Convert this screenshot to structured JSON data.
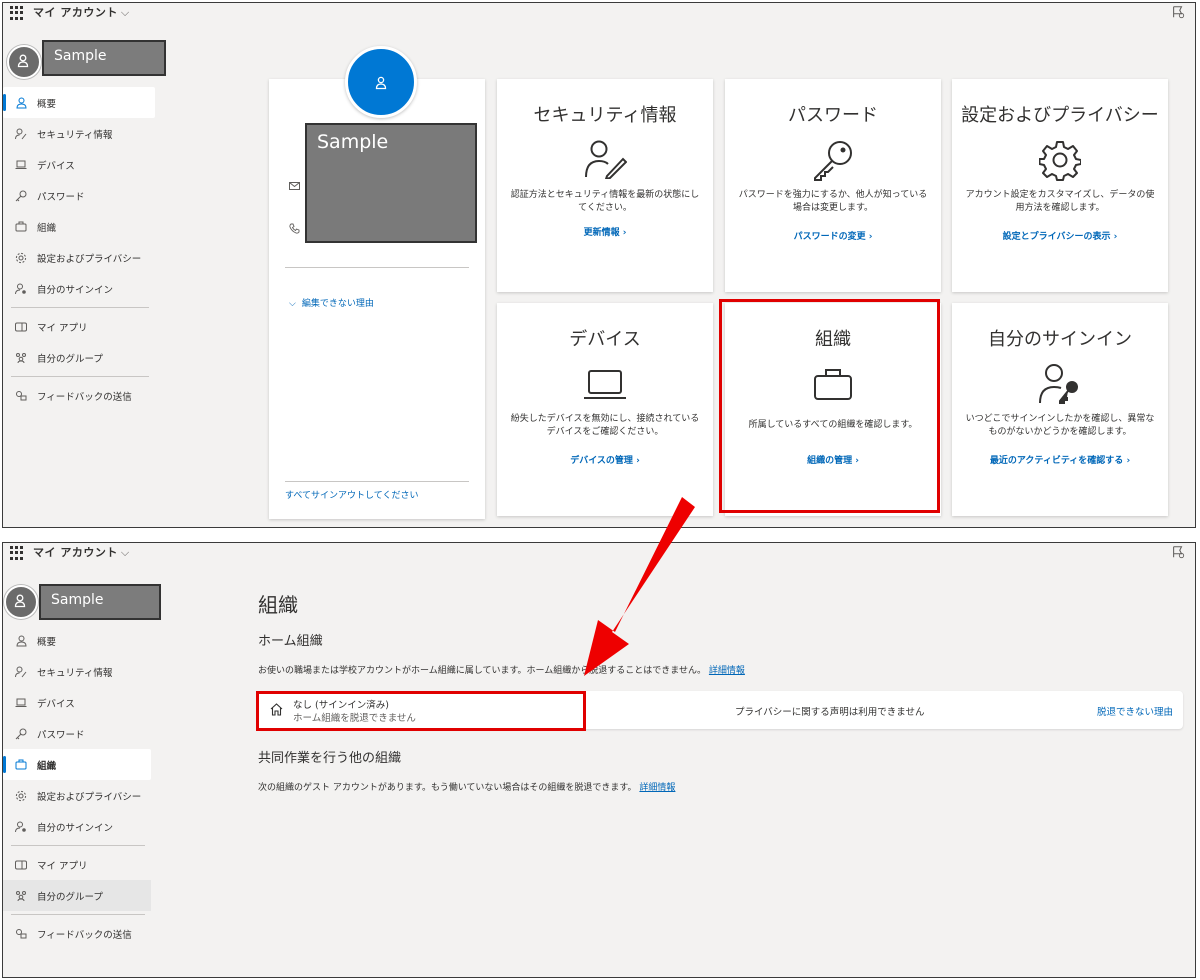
{
  "app": {
    "title": "マイ アカウント"
  },
  "user": {
    "name": "Sample"
  },
  "nav": [
    {
      "label": "概要",
      "icon": "person-icon"
    },
    {
      "label": "セキュリティ情報",
      "icon": "security-info-icon"
    },
    {
      "label": "デバイス",
      "icon": "laptop-icon"
    },
    {
      "label": "パスワード",
      "icon": "key-icon"
    },
    {
      "label": "組織",
      "icon": "briefcase-icon"
    },
    {
      "label": "設定およびプライバシー",
      "icon": "gear-icon"
    },
    {
      "label": "自分のサインイン",
      "icon": "sign-in-icon"
    },
    {
      "label": "マイ アプリ",
      "icon": "apps-icon"
    },
    {
      "label": "自分のグループ",
      "icon": "groups-icon"
    },
    {
      "label": "フィードバックの送信",
      "icon": "feedback-icon"
    }
  ],
  "overview": {
    "edit_reason": "編集できない理由",
    "sign_out_all": "すべてサインアウトしてください",
    "cards": [
      {
        "title": "セキュリティ情報",
        "desc": "認証方法とセキュリティ情報を最新の状態にしてください。",
        "link": "更新情報"
      },
      {
        "title": "パスワード",
        "desc": "パスワードを強力にするか、他人が知っている場合は変更します。",
        "link": "パスワードの変更"
      },
      {
        "title": "設定およびプライバシー",
        "desc": "アカウント設定をカスタマイズし、データの使用方法を確認します。",
        "link": "設定とプライバシーの表示"
      },
      {
        "title": "デバイス",
        "desc": "紛失したデバイスを無効にし、接続されているデバイスをご確認ください。",
        "link": "デバイスの管理"
      },
      {
        "title": "組織",
        "desc": "所属しているすべての組織を確認します。",
        "link": "組織の管理"
      },
      {
        "title": "自分のサインイン",
        "desc": "いつどこでサインインしたかを確認し、異常なものがないかどうかを確認します。",
        "link": "最近のアクティビティを確認する"
      }
    ]
  },
  "org_page": {
    "title": "組織",
    "home_heading": "ホーム組織",
    "home_desc": "お使いの職場または学校アカウントがホーム組織に属しています。ホーム組織から脱退することはできません。",
    "learn_more": "詳細情報",
    "row": {
      "name": "なし (サインイン済み)",
      "sub": "ホーム組織を脱退できません",
      "privacy": "プライバシーに関する声明は利用できません",
      "leave_reason": "脱退できない理由"
    },
    "other_heading": "共同作業を行う他の組織",
    "other_desc": "次の組織のゲスト アカウントがあります。もう働いていない場合はその組織を脱退できます。"
  },
  "colors": {
    "accent": "#0078d4",
    "link": "#0067b8",
    "highlight": "#e00000",
    "arrow": "#ee0000"
  }
}
